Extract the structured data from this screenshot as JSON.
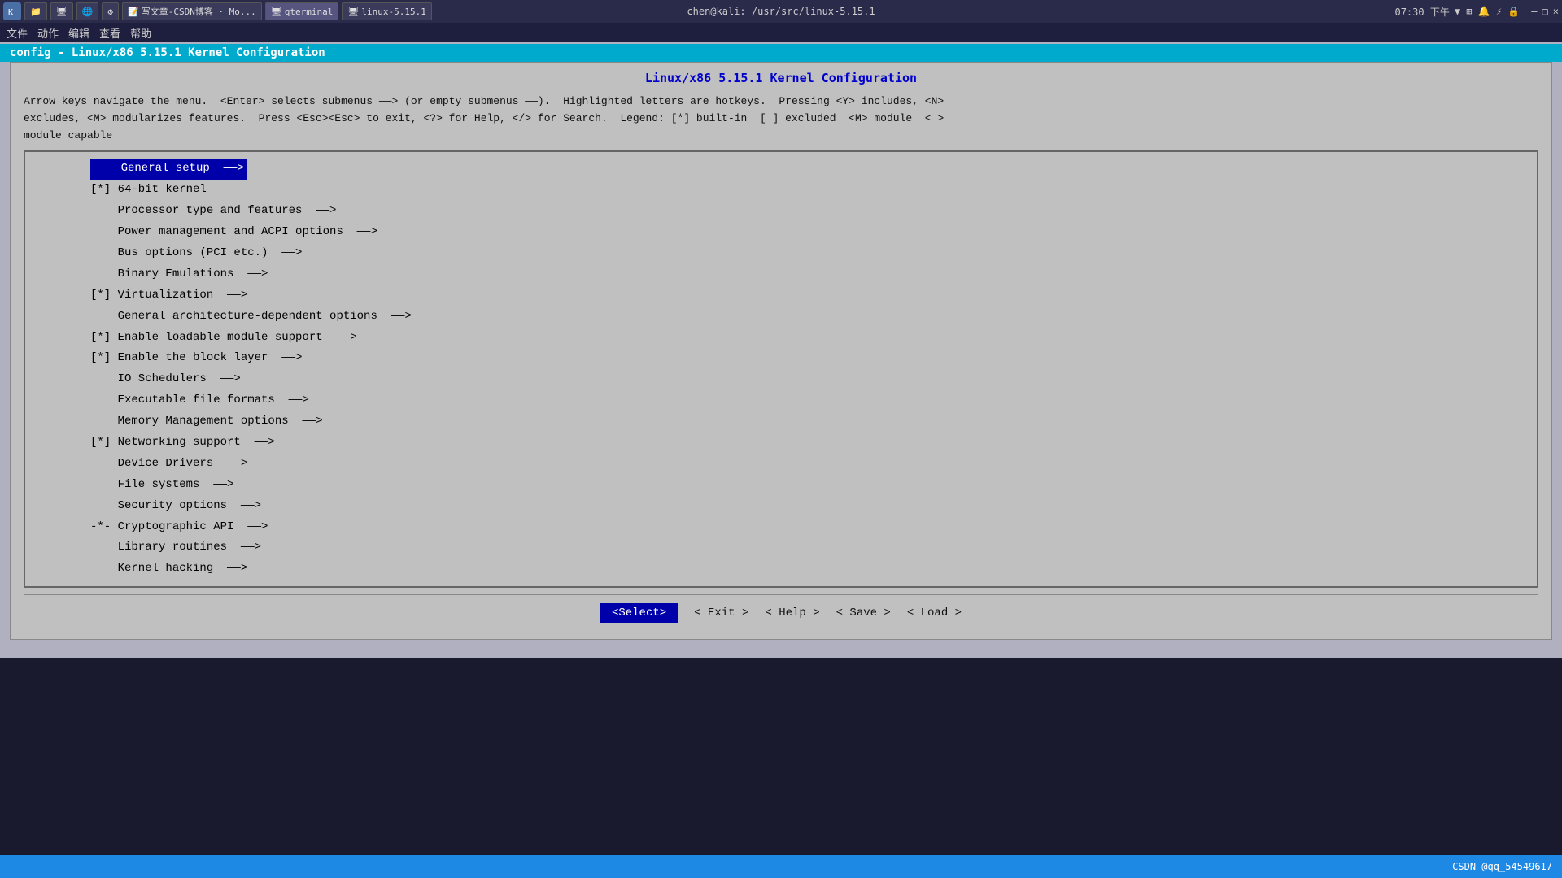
{
  "taskbar": {
    "app_icon_label": "K",
    "tabs": [
      {
        "label": "写文章-CSDN博客 · Mo...",
        "active": false
      },
      {
        "label": "qterminal",
        "active": true
      },
      {
        "label": "linux-5.15.1",
        "active": false
      }
    ],
    "center_text": "chen@kali: /usr/src/linux-5.15.1",
    "time": "07:30 下午",
    "right_icons": "▼ ⊞ 🔔 ⚡ 🔒 ×"
  },
  "menubar": {
    "items": [
      "文件",
      "动作",
      "编辑",
      "查看",
      "帮助"
    ]
  },
  "window_title": "config - Linux/x86 5.15.1 Kernel Configuration",
  "kernel_config": {
    "title": "Linux/x86 5.15.1 Kernel Configuration",
    "help_text": "Arrow keys navigate the menu.  <Enter> selects submenus ---> (or empty submenus ---).  Highlighted letters are hotkeys.  Pressing <Y> includes, <N>\nexcludes, <M> modularizes features.  Press <Esc><Esc> to exit, <?> for Help, </> for Search.  Legend: [*] built-in  [ ] excluded  <M> module  < >\nmodule capable",
    "menu_items": [
      {
        "prefix": "   ",
        "label": "General setup",
        "suffix": " --->",
        "selected": true
      },
      {
        "prefix": "[*] ",
        "label": "64-bit kernel",
        "suffix": "",
        "selected": false
      },
      {
        "prefix": "    ",
        "label": "Processor type and features",
        "suffix": "  --->",
        "selected": false
      },
      {
        "prefix": "    ",
        "label": "Power management and ACPI options",
        "suffix": "  --->",
        "selected": false
      },
      {
        "prefix": "    ",
        "label": "Bus options (PCI etc.)",
        "suffix": "  --->",
        "selected": false
      },
      {
        "prefix": "    ",
        "label": "Binary Emulations",
        "suffix": "  --->",
        "selected": false
      },
      {
        "prefix": "[*] ",
        "label": "Virtualization",
        "suffix": "  --->",
        "selected": false
      },
      {
        "prefix": "    ",
        "label": "General architecture-dependent options",
        "suffix": "  --->",
        "selected": false
      },
      {
        "prefix": "[*] ",
        "label": "Enable loadable module support",
        "suffix": "  --->",
        "selected": false
      },
      {
        "prefix": "[*] ",
        "label": "Enable the block layer",
        "suffix": "  --->",
        "selected": false
      },
      {
        "prefix": "    ",
        "label": "IO Schedulers",
        "suffix": "  --->",
        "selected": false
      },
      {
        "prefix": "    ",
        "label": "Executable file formats",
        "suffix": "  --->",
        "selected": false
      },
      {
        "prefix": "    ",
        "label": "Memory Management options",
        "suffix": "  --->",
        "selected": false
      },
      {
        "prefix": "[*] ",
        "label": "Networking support",
        "suffix": "  --->",
        "selected": false
      },
      {
        "prefix": "    ",
        "label": "Device Drivers",
        "suffix": "  --->",
        "selected": false
      },
      {
        "prefix": "    ",
        "label": "File systems",
        "suffix": "  --->",
        "selected": false
      },
      {
        "prefix": "    ",
        "label": "Security options",
        "suffix": "  --->",
        "selected": false
      },
      {
        "prefix": "-*- ",
        "label": "Cryptographic API",
        "suffix": "  --->",
        "selected": false
      },
      {
        "prefix": "    ",
        "label": "Library routines",
        "suffix": "  --->",
        "selected": false
      },
      {
        "prefix": "    ",
        "label": "Kernel hacking",
        "suffix": "  --->",
        "selected": false
      }
    ],
    "buttons": [
      {
        "label": "<Select>",
        "key": "select",
        "active": true
      },
      {
        "label": "< Exit >",
        "key": "exit",
        "active": false
      },
      {
        "label": "< Help >",
        "key": "help",
        "active": false
      },
      {
        "label": "< Save >",
        "key": "save",
        "active": false
      },
      {
        "label": "< Load >",
        "key": "load",
        "active": false
      }
    ]
  },
  "statusbar": {
    "text": "CSDN @qq_54549617"
  }
}
